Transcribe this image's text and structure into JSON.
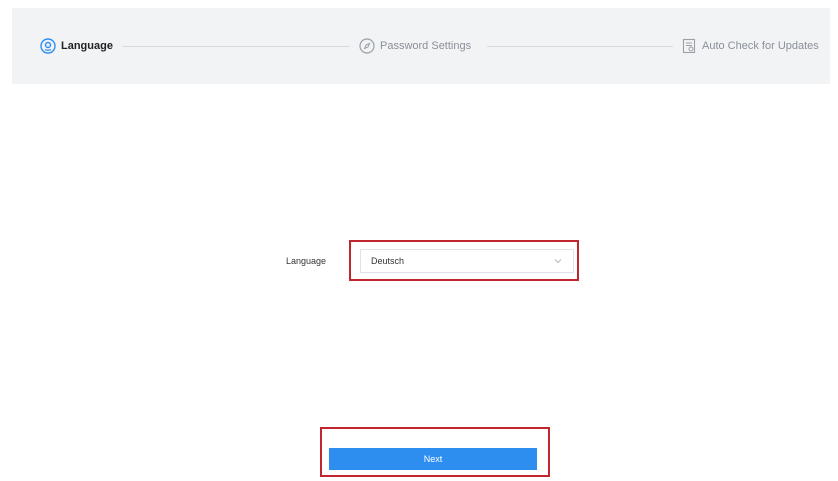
{
  "steps": [
    {
      "label": "Language",
      "icon": "location-pin-icon",
      "active": true
    },
    {
      "label": "Password Settings",
      "icon": "compass-icon",
      "active": false
    },
    {
      "label": "Auto Check for Updates",
      "icon": "document-update-icon",
      "active": false
    }
  ],
  "form": {
    "language_label": "Language",
    "language_value": "Deutsch"
  },
  "actions": {
    "next_label": "Next"
  },
  "colors": {
    "accent": "#2e8ef0",
    "highlight": "#c0262d",
    "header_bg": "#f2f3f5"
  }
}
